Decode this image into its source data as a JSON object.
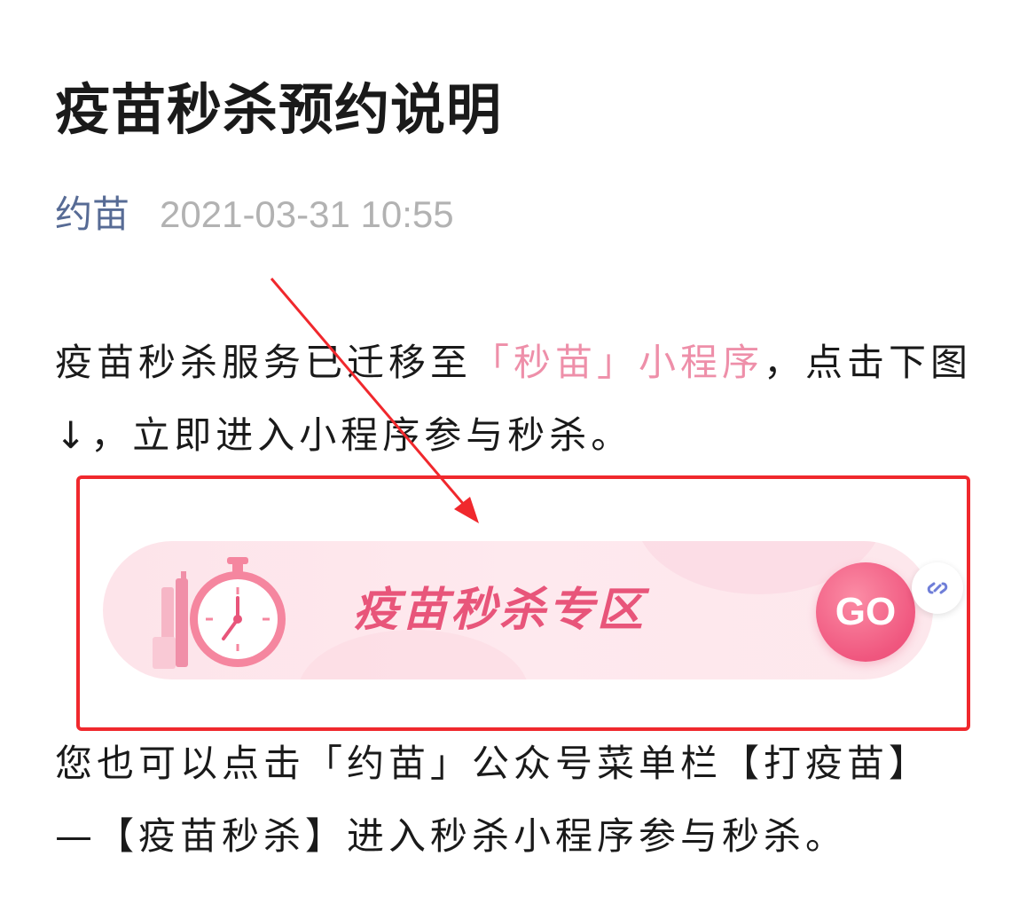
{
  "article": {
    "title": "疫苗秒杀预约说明",
    "author": "约苗",
    "datetime": "2021-03-31 10:55"
  },
  "paragraph1": {
    "prefix": "疫苗秒杀服务已迁移至",
    "highlight": "「秒苗」小程序",
    "suffix": "，点击下图↓，立即进入小程序参与秒杀。"
  },
  "banner": {
    "title": "疫苗秒杀专区",
    "go_label": "GO",
    "icon": "stopwatch-icon",
    "link_icon": "mini-program-link-icon"
  },
  "paragraph2": {
    "text": "您也可以点击「约苗」公众号菜单栏【打疫苗】—【疫苗秒杀】进入秒杀小程序参与秒杀。"
  },
  "colors": {
    "author": "#576b95",
    "highlight": "#ee8fa9",
    "annotation_red": "#f0282d",
    "banner_pink": "#e8557a"
  }
}
